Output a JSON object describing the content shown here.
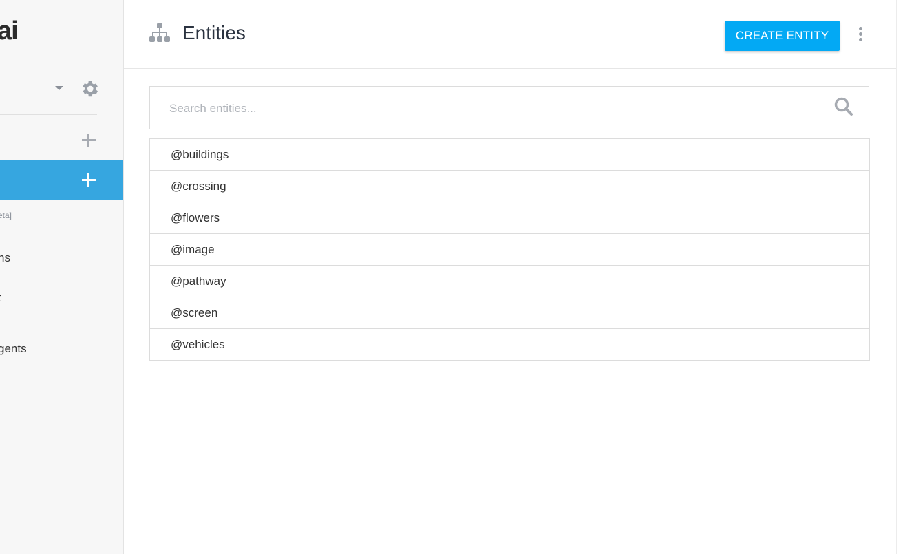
{
  "sidebar": {
    "logo_text": "ai",
    "small_label": "eta]",
    "items": [
      {
        "label": "ns"
      },
      {
        "label": "t"
      },
      {
        "label": "gents"
      }
    ],
    "icons": {
      "caret": "chevron-down-icon",
      "settings": "gear-icon",
      "add": "plus-icon"
    }
  },
  "header": {
    "title": "Entities",
    "icon": "sitemap-icon",
    "create_button_label": "CREATE ENTITY",
    "more_icon": "more-vertical-icon"
  },
  "search": {
    "placeholder": "Search entities...",
    "value": ""
  },
  "entities": [
    {
      "name": "@buildings"
    },
    {
      "name": "@crossing"
    },
    {
      "name": "@flowers"
    },
    {
      "name": "@image"
    },
    {
      "name": "@pathway"
    },
    {
      "name": "@screen"
    },
    {
      "name": "@vehicles"
    }
  ],
  "colors": {
    "accent": "#03a9f4",
    "active_sidebar": "#36a6e0",
    "icon_gray": "#9aa0a8"
  }
}
